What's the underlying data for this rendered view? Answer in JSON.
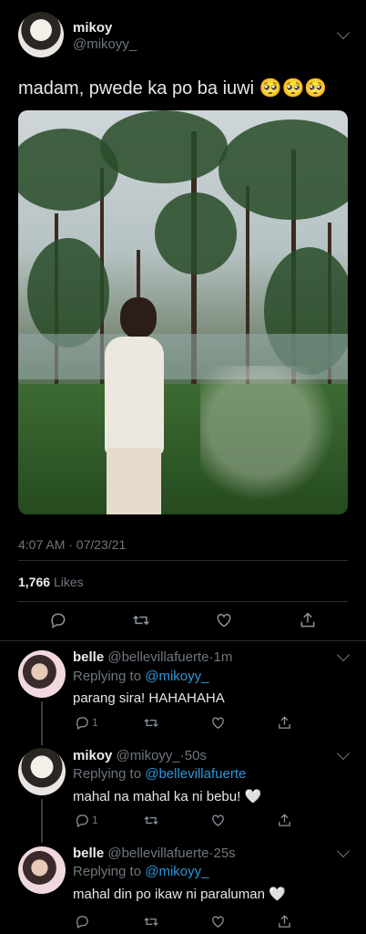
{
  "tweet": {
    "author_name": "mikoy",
    "author_handle": "@mikoyy_",
    "text": "madam, pwede ka po ba iuwi 🥺🥺🥺",
    "timestamp": "4:07 AM · 07/23/21",
    "likes_count": "1,766",
    "likes_label": "Likes"
  },
  "replies": [
    {
      "name": "belle",
      "handle": "@bellevillafuerte",
      "time": "1m",
      "replying_label": "Replying to",
      "replying_to": "@mikoyy_",
      "text": "parang sira! HAHAHAHA",
      "reply_count": "1"
    },
    {
      "name": "mikoy",
      "handle": "@mikoyy_",
      "time": "50s",
      "replying_label": "Replying to",
      "replying_to": "@bellevillafuerte",
      "text": "mahal na mahal ka ni bebu! 🤍",
      "reply_count": "1"
    },
    {
      "name": "belle",
      "handle": "@bellevillafuerte",
      "time": "25s",
      "replying_label": "Replying to",
      "replying_to": "@mikoyy_",
      "text": "mahal din po ikaw ni paraluman 🤍",
      "reply_count": ""
    }
  ],
  "colors": {
    "background": "#000000",
    "muted": "#6e767d",
    "link": "#2f96d9",
    "text": "#d9d9d9"
  }
}
